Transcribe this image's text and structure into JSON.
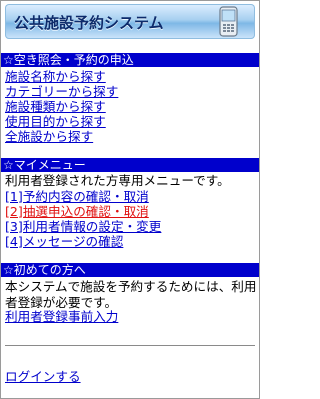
{
  "header": {
    "title": "公共施設予約システム"
  },
  "search_section": {
    "heading": "☆空き照会・予約の申込",
    "links": [
      "施設名称から探す",
      "カテゴリーから探す",
      "施設種類から探す",
      "使用目的から探す",
      "全施設から探す"
    ]
  },
  "my_menu": {
    "heading": "☆マイメニュー",
    "intro": "利用者登録された方専用メニューです。",
    "links": [
      "[1]予約内容の確認・取消",
      "[2]抽選申込の確認・取消",
      "[3]利用者情報の設定・変更",
      "[4]メッセージの確認"
    ]
  },
  "first_time": {
    "heading": "☆初めての方へ",
    "text": "本システムで施設を予約するためには、利用者登録が必要です。",
    "link": "利用者登録事前入力"
  },
  "login": {
    "link": "ログインする"
  },
  "colors": {
    "section_bar": "#0000cc",
    "link": "#0000cc",
    "highlight_link": "#e01010"
  }
}
